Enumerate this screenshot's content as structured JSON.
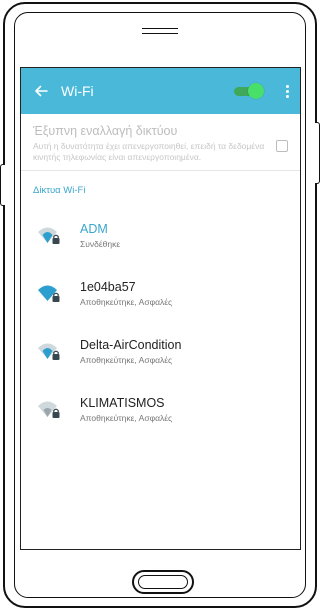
{
  "appbar": {
    "title": "Wi-Fi",
    "wifi_enabled": true,
    "back_icon": "arrow-left-icon",
    "menu_icon": "more-vert-icon"
  },
  "smart_switch": {
    "title": "Έξυπνη εναλλαγή δικτύου",
    "description": "Αυτή η δυνατότητα έχει απενεργοποιηθεί, επειδή τα δεδομένα κινητής τηλεφωνίας είναι απενεργοποιημένα.",
    "checked": false
  },
  "networks_section": {
    "label": "Δίκτυα Wi-Fi"
  },
  "networks": [
    {
      "name": "ADM",
      "status": "Συνδέθηκε",
      "connected": true,
      "signal": 3
    },
    {
      "name": "1e04ba57",
      "status": "Αποθηκεύτηκε, Ασφαλές",
      "connected": false,
      "signal": 4
    },
    {
      "name": "Delta-AirCondition",
      "status": "Αποθηκεύτηκε, Ασφαλές",
      "connected": false,
      "signal": 3
    },
    {
      "name": "KLIMATISMOS",
      "status": "Αποθηκεύτηκε, Ασφαλές",
      "connected": false,
      "signal": 2
    }
  ],
  "colors": {
    "accent": "#4ab9d9",
    "link": "#3aa6cc",
    "toggle_on": "#49e06a",
    "icon_active": "#2c9fcf",
    "icon_dim": "#9aa6ab"
  }
}
